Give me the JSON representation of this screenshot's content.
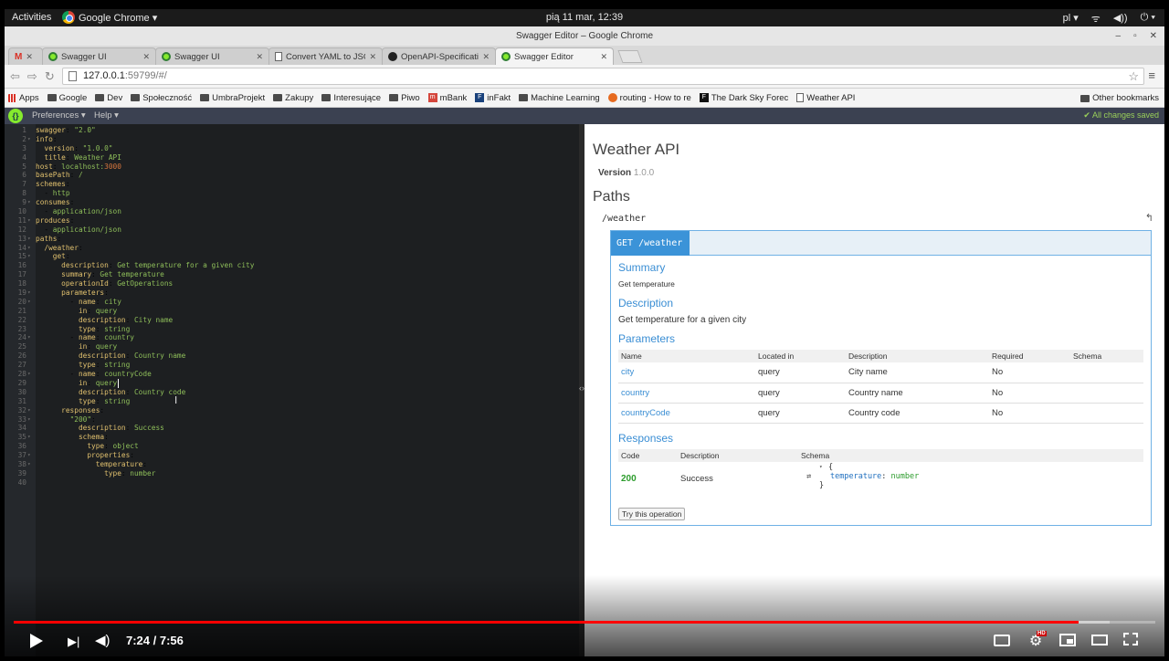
{
  "topbar": {
    "activities": "Activities",
    "app": "Google Chrome ▾",
    "clock": "pią 11 mar, 12:39",
    "lang": "pl ▾",
    "tray_icons": [
      "wifi-icon",
      "volume-icon",
      "power-icon"
    ]
  },
  "window": {
    "title": "Swagger Editor – Google Chrome"
  },
  "tabs": [
    {
      "label": "",
      "favicon": "gmail-icon"
    },
    {
      "label": "Swagger UI",
      "favicon": "swagger-icon"
    },
    {
      "label": "Swagger UI",
      "favicon": "swagger-icon"
    },
    {
      "label": "Convert YAML to JSON",
      "favicon": "page-icon"
    },
    {
      "label": "OpenAPI-Specification/",
      "favicon": "github-icon"
    },
    {
      "label": "Swagger Editor",
      "favicon": "swagger-icon"
    }
  ],
  "address": {
    "host": "127.0.0.1",
    "rest": ":59799/#/"
  },
  "bookmarks": [
    {
      "label": "Apps",
      "icon": "apps-icon"
    },
    {
      "label": "Google",
      "icon": "folder-icon"
    },
    {
      "label": "Dev",
      "icon": "folder-icon"
    },
    {
      "label": "Społeczność",
      "icon": "folder-icon"
    },
    {
      "label": "UmbraProjekt",
      "icon": "folder-icon"
    },
    {
      "label": "Zakupy",
      "icon": "folder-icon"
    },
    {
      "label": "Interesujące",
      "icon": "folder-icon"
    },
    {
      "label": "Piwo",
      "icon": "folder-icon"
    },
    {
      "label": "mBank",
      "icon": "mbank-icon"
    },
    {
      "label": "inFakt",
      "icon": "infakt-icon"
    },
    {
      "label": "Machine Learning",
      "icon": "folder-icon"
    },
    {
      "label": "routing - How to re",
      "icon": "routing-icon"
    },
    {
      "label": "The Dark Sky Forec",
      "icon": "darksky-icon"
    },
    {
      "label": "Weather API",
      "icon": "page-icon"
    }
  ],
  "other_bookmarks": "Other bookmarks",
  "swagger_header": {
    "logo": "{}",
    "preferences": "Preferences ▾",
    "help": "Help ▾",
    "saved": "✔ All changes saved"
  },
  "editor": {
    "lines": [
      [
        [
          "k",
          "swagger"
        ],
        [
          "p",
          ": "
        ],
        [
          "v",
          "\"2.0\""
        ]
      ],
      [
        [
          "k",
          "info"
        ],
        [
          "p",
          ":"
        ]
      ],
      [
        [
          "p",
          "  "
        ],
        [
          "k",
          "version"
        ],
        [
          "p",
          ": "
        ],
        [
          "v",
          "\"1.0.0\""
        ]
      ],
      [
        [
          "p",
          "  "
        ],
        [
          "k",
          "title"
        ],
        [
          "p",
          ": "
        ],
        [
          "v",
          "Weather API"
        ]
      ],
      [
        [
          "k",
          "host"
        ],
        [
          "p",
          ": "
        ],
        [
          "v",
          "localhost:"
        ],
        [
          "n",
          "3000"
        ]
      ],
      [
        [
          "k",
          "basePath"
        ],
        [
          "p",
          ": "
        ],
        [
          "v",
          "/"
        ]
      ],
      [
        [
          "k",
          "schemes"
        ],
        [
          "p",
          ":"
        ]
      ],
      [
        [
          "p",
          "  - "
        ],
        [
          "v",
          "http"
        ]
      ],
      [
        [
          "k",
          "consumes"
        ],
        [
          "p",
          ":"
        ]
      ],
      [
        [
          "p",
          "  - "
        ],
        [
          "v",
          "application/json"
        ]
      ],
      [
        [
          "k",
          "produces"
        ],
        [
          "p",
          ":"
        ]
      ],
      [
        [
          "p",
          "  - "
        ],
        [
          "v",
          "application/json"
        ]
      ],
      [
        [
          "k",
          "paths"
        ],
        [
          "p",
          ":"
        ]
      ],
      [
        [
          "p",
          "  "
        ],
        [
          "k",
          "/weather"
        ],
        [
          "p",
          ":"
        ]
      ],
      [
        [
          "p",
          "    "
        ],
        [
          "k",
          "get"
        ],
        [
          "p",
          ":"
        ]
      ],
      [
        [
          "p",
          "      "
        ],
        [
          "k",
          "description"
        ],
        [
          "p",
          ": "
        ],
        [
          "v",
          "Get temperature for a given city"
        ]
      ],
      [
        [
          "p",
          "      "
        ],
        [
          "k",
          "summary"
        ],
        [
          "p",
          ": "
        ],
        [
          "v",
          "Get temperature"
        ]
      ],
      [
        [
          "p",
          "      "
        ],
        [
          "k",
          "operationId"
        ],
        [
          "p",
          ": "
        ],
        [
          "v",
          "GetOperations"
        ]
      ],
      [
        [
          "p",
          "      "
        ],
        [
          "k",
          "parameters"
        ],
        [
          "p",
          ":"
        ]
      ],
      [
        [
          "p",
          "        - "
        ],
        [
          "k",
          "name"
        ],
        [
          "p",
          ": "
        ],
        [
          "v",
          "city"
        ]
      ],
      [
        [
          "p",
          "          "
        ],
        [
          "k",
          "in"
        ],
        [
          "p",
          ": "
        ],
        [
          "v",
          "query"
        ]
      ],
      [
        [
          "p",
          "          "
        ],
        [
          "k",
          "description"
        ],
        [
          "p",
          ": "
        ],
        [
          "v",
          "City name"
        ]
      ],
      [
        [
          "p",
          "          "
        ],
        [
          "k",
          "type"
        ],
        [
          "p",
          ": "
        ],
        [
          "v",
          "string"
        ]
      ],
      [
        [
          "p",
          "        - "
        ],
        [
          "k",
          "name"
        ],
        [
          "p",
          ": "
        ],
        [
          "v",
          "country"
        ]
      ],
      [
        [
          "p",
          "          "
        ],
        [
          "k",
          "in"
        ],
        [
          "p",
          ": "
        ],
        [
          "v",
          "query"
        ]
      ],
      [
        [
          "p",
          "          "
        ],
        [
          "k",
          "description"
        ],
        [
          "p",
          ": "
        ],
        [
          "v",
          "Country name"
        ]
      ],
      [
        [
          "p",
          "          "
        ],
        [
          "k",
          "type"
        ],
        [
          "p",
          ": "
        ],
        [
          "v",
          "string"
        ]
      ],
      [
        [
          "p",
          "        - "
        ],
        [
          "k",
          "name"
        ],
        [
          "p",
          ": "
        ],
        [
          "v",
          "countryCode"
        ]
      ],
      [
        [
          "p",
          "          "
        ],
        [
          "k",
          "in"
        ],
        [
          "p",
          ": "
        ],
        [
          "v",
          "query"
        ]
      ],
      [
        [
          "p",
          "          "
        ],
        [
          "k",
          "description"
        ],
        [
          "p",
          ": "
        ],
        [
          "v",
          "Country code"
        ]
      ],
      [
        [
          "p",
          "          "
        ],
        [
          "k",
          "type"
        ],
        [
          "p",
          ": "
        ],
        [
          "v",
          "string"
        ]
      ],
      [
        [
          "p",
          "      "
        ],
        [
          "k",
          "responses"
        ],
        [
          "p",
          ":"
        ]
      ],
      [
        [
          "p",
          "        "
        ],
        [
          "v",
          "\"200\""
        ],
        [
          "p",
          ":"
        ]
      ],
      [
        [
          "p",
          "          "
        ],
        [
          "k",
          "description"
        ],
        [
          "p",
          ": "
        ],
        [
          "v",
          "Success"
        ]
      ],
      [
        [
          "p",
          "          "
        ],
        [
          "k",
          "schema"
        ],
        [
          "p",
          ":"
        ]
      ],
      [
        [
          "p",
          "            "
        ],
        [
          "k",
          "type"
        ],
        [
          "p",
          ": "
        ],
        [
          "v",
          "object"
        ]
      ],
      [
        [
          "p",
          "            "
        ],
        [
          "k",
          "properties"
        ],
        [
          "p",
          ":"
        ]
      ],
      [
        [
          "p",
          "              "
        ],
        [
          "k",
          "temperature"
        ],
        [
          "p",
          ":"
        ]
      ],
      [
        [
          "p",
          "                "
        ],
        [
          "k",
          "type"
        ],
        [
          "p",
          ": "
        ],
        [
          "v",
          "number"
        ]
      ],
      []
    ],
    "folds": [
      2,
      9,
      11,
      13,
      14,
      15,
      19,
      20,
      24,
      28,
      32,
      33,
      35,
      37,
      38
    ]
  },
  "preview": {
    "title": "Weather API",
    "version_label": "Version",
    "version": "1.0.0",
    "paths_heading": "Paths",
    "path": "/weather",
    "operation": {
      "method_path": "GET /weather",
      "summary_heading": "Summary",
      "summary": "Get temperature",
      "description_heading": "Description",
      "description": "Get temperature for a given city",
      "parameters_heading": "Parameters",
      "param_columns": [
        "Name",
        "Located in",
        "Description",
        "Required",
        "Schema"
      ],
      "params": [
        {
          "name": "city",
          "in": "query",
          "description": "City name",
          "required": "No",
          "schema": ""
        },
        {
          "name": "country",
          "in": "query",
          "description": "Country name",
          "required": "No",
          "schema": ""
        },
        {
          "name": "countryCode",
          "in": "query",
          "description": "Country code",
          "required": "No",
          "schema": ""
        }
      ],
      "responses_heading": "Responses",
      "resp_columns": [
        "Code",
        "Description",
        "Schema"
      ],
      "responses": [
        {
          "code": "200",
          "description": "Success",
          "schema_prop": "temperature",
          "schema_type": "number"
        }
      ],
      "try_button": "Try this operation"
    }
  },
  "video": {
    "time": "7:24 / 7:56",
    "progress": 0.933,
    "buffered": 0.96,
    "hd_badge": "HD"
  }
}
